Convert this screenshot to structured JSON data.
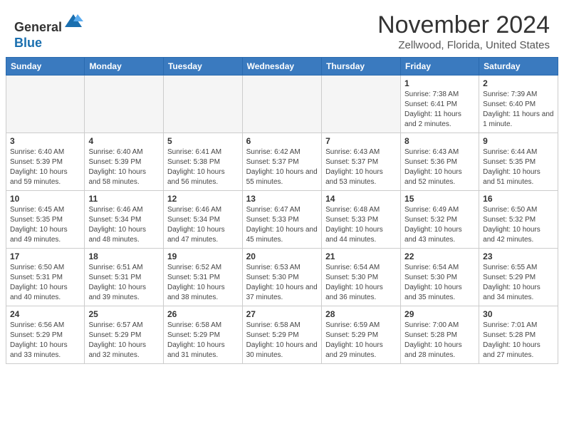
{
  "header": {
    "logo_line1": "General",
    "logo_line2": "Blue",
    "month_title": "November 2024",
    "location": "Zellwood, Florida, United States"
  },
  "weekdays": [
    "Sunday",
    "Monday",
    "Tuesday",
    "Wednesday",
    "Thursday",
    "Friday",
    "Saturday"
  ],
  "weeks": [
    [
      {
        "day": "",
        "info": ""
      },
      {
        "day": "",
        "info": ""
      },
      {
        "day": "",
        "info": ""
      },
      {
        "day": "",
        "info": ""
      },
      {
        "day": "",
        "info": ""
      },
      {
        "day": "1",
        "info": "Sunrise: 7:38 AM\nSunset: 6:41 PM\nDaylight: 11 hours and 2 minutes."
      },
      {
        "day": "2",
        "info": "Sunrise: 7:39 AM\nSunset: 6:40 PM\nDaylight: 11 hours and 1 minute."
      }
    ],
    [
      {
        "day": "3",
        "info": "Sunrise: 6:40 AM\nSunset: 5:39 PM\nDaylight: 10 hours and 59 minutes."
      },
      {
        "day": "4",
        "info": "Sunrise: 6:40 AM\nSunset: 5:39 PM\nDaylight: 10 hours and 58 minutes."
      },
      {
        "day": "5",
        "info": "Sunrise: 6:41 AM\nSunset: 5:38 PM\nDaylight: 10 hours and 56 minutes."
      },
      {
        "day": "6",
        "info": "Sunrise: 6:42 AM\nSunset: 5:37 PM\nDaylight: 10 hours and 55 minutes."
      },
      {
        "day": "7",
        "info": "Sunrise: 6:43 AM\nSunset: 5:37 PM\nDaylight: 10 hours and 53 minutes."
      },
      {
        "day": "8",
        "info": "Sunrise: 6:43 AM\nSunset: 5:36 PM\nDaylight: 10 hours and 52 minutes."
      },
      {
        "day": "9",
        "info": "Sunrise: 6:44 AM\nSunset: 5:35 PM\nDaylight: 10 hours and 51 minutes."
      }
    ],
    [
      {
        "day": "10",
        "info": "Sunrise: 6:45 AM\nSunset: 5:35 PM\nDaylight: 10 hours and 49 minutes."
      },
      {
        "day": "11",
        "info": "Sunrise: 6:46 AM\nSunset: 5:34 PM\nDaylight: 10 hours and 48 minutes."
      },
      {
        "day": "12",
        "info": "Sunrise: 6:46 AM\nSunset: 5:34 PM\nDaylight: 10 hours and 47 minutes."
      },
      {
        "day": "13",
        "info": "Sunrise: 6:47 AM\nSunset: 5:33 PM\nDaylight: 10 hours and 45 minutes."
      },
      {
        "day": "14",
        "info": "Sunrise: 6:48 AM\nSunset: 5:33 PM\nDaylight: 10 hours and 44 minutes."
      },
      {
        "day": "15",
        "info": "Sunrise: 6:49 AM\nSunset: 5:32 PM\nDaylight: 10 hours and 43 minutes."
      },
      {
        "day": "16",
        "info": "Sunrise: 6:50 AM\nSunset: 5:32 PM\nDaylight: 10 hours and 42 minutes."
      }
    ],
    [
      {
        "day": "17",
        "info": "Sunrise: 6:50 AM\nSunset: 5:31 PM\nDaylight: 10 hours and 40 minutes."
      },
      {
        "day": "18",
        "info": "Sunrise: 6:51 AM\nSunset: 5:31 PM\nDaylight: 10 hours and 39 minutes."
      },
      {
        "day": "19",
        "info": "Sunrise: 6:52 AM\nSunset: 5:31 PM\nDaylight: 10 hours and 38 minutes."
      },
      {
        "day": "20",
        "info": "Sunrise: 6:53 AM\nSunset: 5:30 PM\nDaylight: 10 hours and 37 minutes."
      },
      {
        "day": "21",
        "info": "Sunrise: 6:54 AM\nSunset: 5:30 PM\nDaylight: 10 hours and 36 minutes."
      },
      {
        "day": "22",
        "info": "Sunrise: 6:54 AM\nSunset: 5:30 PM\nDaylight: 10 hours and 35 minutes."
      },
      {
        "day": "23",
        "info": "Sunrise: 6:55 AM\nSunset: 5:29 PM\nDaylight: 10 hours and 34 minutes."
      }
    ],
    [
      {
        "day": "24",
        "info": "Sunrise: 6:56 AM\nSunset: 5:29 PM\nDaylight: 10 hours and 33 minutes."
      },
      {
        "day": "25",
        "info": "Sunrise: 6:57 AM\nSunset: 5:29 PM\nDaylight: 10 hours and 32 minutes."
      },
      {
        "day": "26",
        "info": "Sunrise: 6:58 AM\nSunset: 5:29 PM\nDaylight: 10 hours and 31 minutes."
      },
      {
        "day": "27",
        "info": "Sunrise: 6:58 AM\nSunset: 5:29 PM\nDaylight: 10 hours and 30 minutes."
      },
      {
        "day": "28",
        "info": "Sunrise: 6:59 AM\nSunset: 5:29 PM\nDaylight: 10 hours and 29 minutes."
      },
      {
        "day": "29",
        "info": "Sunrise: 7:00 AM\nSunset: 5:28 PM\nDaylight: 10 hours and 28 minutes."
      },
      {
        "day": "30",
        "info": "Sunrise: 7:01 AM\nSunset: 5:28 PM\nDaylight: 10 hours and 27 minutes."
      }
    ]
  ]
}
